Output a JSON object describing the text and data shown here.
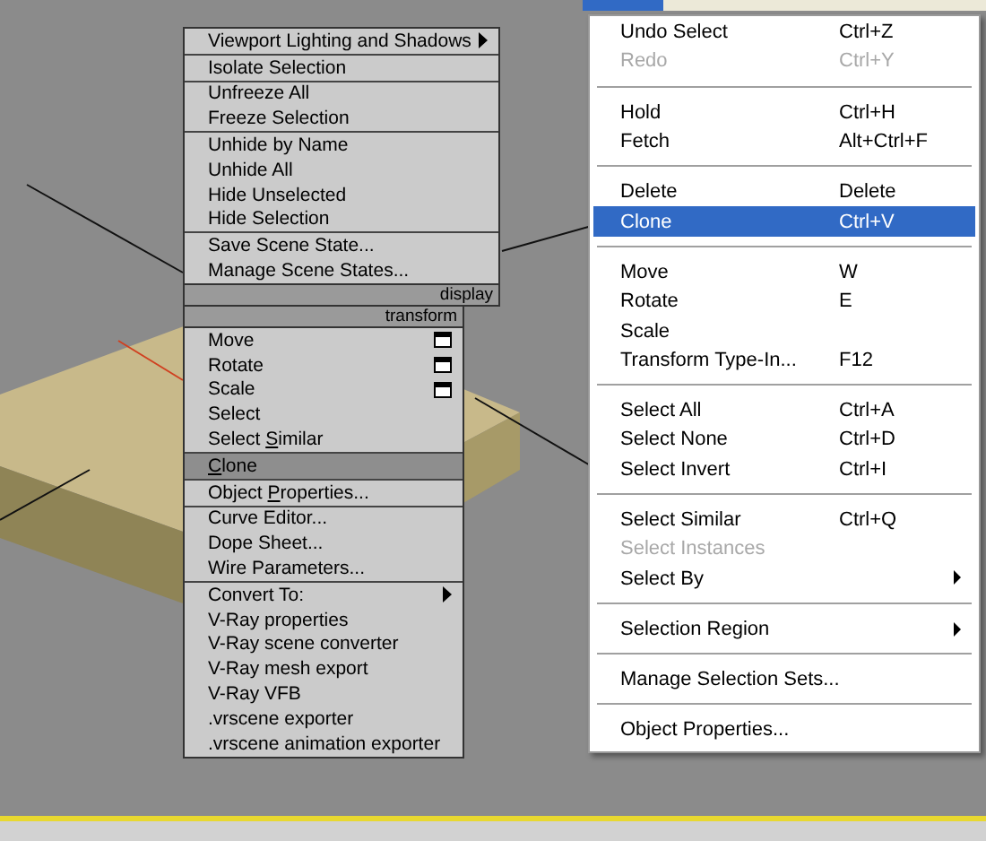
{
  "quad_menu": {
    "sections": [
      {
        "header": "display",
        "groups": [
          [
            {
              "label": "Viewport Lighting and Shadows",
              "kind": "submenu",
              "selected": false
            }
          ],
          [
            {
              "label": "Isolate Selection",
              "kind": "plain",
              "selected": false
            }
          ],
          [
            {
              "label": "Unfreeze All",
              "kind": "plain",
              "selected": false
            },
            {
              "label": "Freeze Selection",
              "kind": "plain",
              "selected": false
            }
          ],
          [
            {
              "label": "Unhide by Name",
              "kind": "plain",
              "selected": false
            },
            {
              "label": "Unhide All",
              "kind": "plain",
              "selected": false
            },
            {
              "label": "Hide Unselected",
              "kind": "plain",
              "selected": false
            },
            {
              "label": "Hide Selection",
              "kind": "plain",
              "selected": false
            }
          ],
          [
            {
              "label": "Save Scene State...",
              "kind": "plain",
              "selected": false
            },
            {
              "label": "Manage Scene States...",
              "kind": "plain",
              "selected": false
            }
          ]
        ]
      },
      {
        "header": "transform",
        "groups": [
          [
            {
              "label": "Move",
              "kind": "options",
              "selected": false
            },
            {
              "label": "Rotate",
              "kind": "options",
              "selected": false
            },
            {
              "label": "Scale",
              "kind": "options",
              "selected": false
            },
            {
              "label": "Select",
              "kind": "plain",
              "selected": false
            },
            {
              "mnemonic_label": {
                "before": "Select ",
                "key": "S",
                "after": "imilar"
              },
              "kind": "plain",
              "selected": false
            }
          ],
          [
            {
              "mnemonic_label": {
                "key": "C",
                "after": "lone"
              },
              "kind": "plain",
              "selected": true
            }
          ],
          [
            {
              "mnemonic_label": {
                "before": "Object ",
                "key": "P",
                "after": "roperties..."
              },
              "kind": "plain",
              "selected": false
            }
          ],
          [
            {
              "label": "Curve Editor...",
              "kind": "plain",
              "selected": false
            },
            {
              "label": "Dope Sheet...",
              "kind": "plain",
              "selected": false
            },
            {
              "label": "Wire Parameters...",
              "kind": "plain",
              "selected": false
            }
          ],
          [
            {
              "label": "Convert To:",
              "kind": "submenu",
              "selected": false
            },
            {
              "label": "V-Ray properties",
              "kind": "plain",
              "selected": false
            },
            {
              "label": "V-Ray scene converter",
              "kind": "plain",
              "selected": false
            },
            {
              "label": "V-Ray mesh export",
              "kind": "plain",
              "selected": false
            },
            {
              "label": "V-Ray VFB",
              "kind": "plain",
              "selected": false
            },
            {
              "label": ".vrscene exporter",
              "kind": "plain",
              "selected": false
            },
            {
              "label": ".vrscene animation exporter",
              "kind": "plain",
              "selected": false
            }
          ]
        ]
      }
    ]
  },
  "edit_menu": {
    "groups": [
      [
        {
          "label": "Undo Select",
          "shortcut": "Ctrl+Z",
          "disabled": false,
          "selected": false,
          "submenu": false
        },
        {
          "label": "Redo",
          "shortcut": "Ctrl+Y",
          "disabled": true,
          "selected": false,
          "submenu": false
        }
      ],
      [
        {
          "label": "Hold",
          "shortcut": "Ctrl+H",
          "disabled": false,
          "selected": false,
          "submenu": false
        },
        {
          "label": "Fetch",
          "shortcut": "Alt+Ctrl+F",
          "disabled": false,
          "selected": false,
          "submenu": false
        }
      ],
      [
        {
          "label": "Delete",
          "shortcut": "Delete",
          "disabled": false,
          "selected": false,
          "submenu": false
        },
        {
          "label": "Clone",
          "shortcut": "Ctrl+V",
          "disabled": false,
          "selected": true,
          "submenu": false
        }
      ],
      [
        {
          "label": "Move",
          "shortcut": "W",
          "disabled": false,
          "selected": false,
          "submenu": false
        },
        {
          "label": "Rotate",
          "shortcut": "E",
          "disabled": false,
          "selected": false,
          "submenu": false
        },
        {
          "label": "Scale",
          "disabled": false,
          "selected": false,
          "submenu": false
        },
        {
          "label": "Transform Type-In...",
          "shortcut": "F12",
          "disabled": false,
          "selected": false,
          "submenu": false
        }
      ],
      [
        {
          "label": "Select All",
          "shortcut": "Ctrl+A",
          "disabled": false,
          "selected": false,
          "submenu": false
        },
        {
          "label": "Select None",
          "shortcut": "Ctrl+D",
          "disabled": false,
          "selected": false,
          "submenu": false
        },
        {
          "label": "Select Invert",
          "shortcut": "Ctrl+I",
          "disabled": false,
          "selected": false,
          "submenu": false
        }
      ],
      [
        {
          "label": "Select Similar",
          "shortcut": "Ctrl+Q",
          "disabled": false,
          "selected": false,
          "submenu": false
        },
        {
          "label": "Select Instances",
          "disabled": true,
          "selected": false,
          "submenu": false
        },
        {
          "label": "Select By",
          "disabled": false,
          "selected": false,
          "submenu": true
        }
      ],
      [
        {
          "label": "Selection Region",
          "disabled": false,
          "selected": false,
          "submenu": true
        }
      ],
      [
        {
          "label": "Manage Selection Sets...",
          "disabled": false,
          "selected": false,
          "submenu": false
        }
      ],
      [
        {
          "label": "Object Properties...",
          "disabled": false,
          "selected": false,
          "submenu": false
        }
      ]
    ]
  }
}
